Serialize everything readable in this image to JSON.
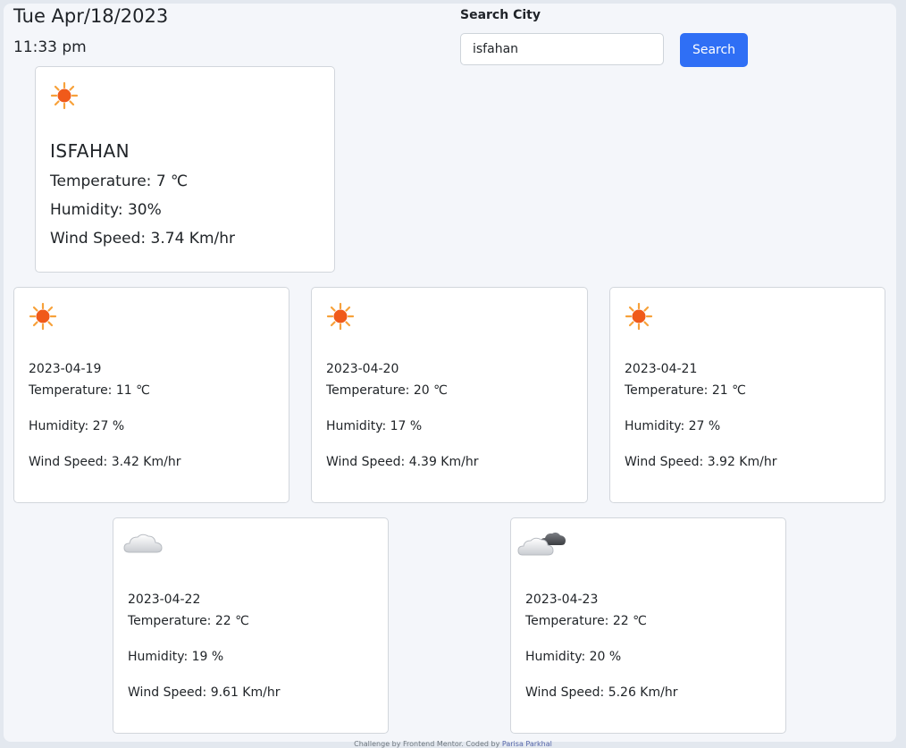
{
  "header": {
    "date": "Tue Apr/18/2023",
    "time": "11:33 pm"
  },
  "search": {
    "label": "Search City",
    "value": "isfahan",
    "placeholder": "",
    "button": "Search"
  },
  "current": {
    "icon": "sun-icon",
    "city": "ISFAHAN",
    "temperature": "Temperature: 7 ℃",
    "humidity": "Humidity: 30%",
    "wind": "Wind Speed: 3.74 Km/hr"
  },
  "forecast": [
    {
      "icon": "sun-icon",
      "date": "2023-04-19",
      "temperature": "Temperature: 11 ℃",
      "humidity": "Humidity: 27 %",
      "wind": "Wind Speed: 3.42 Km/hr"
    },
    {
      "icon": "sun-icon",
      "date": "2023-04-20",
      "temperature": "Temperature: 20 ℃",
      "humidity": "Humidity: 17 %",
      "wind": "Wind Speed: 4.39 Km/hr"
    },
    {
      "icon": "sun-icon",
      "date": "2023-04-21",
      "temperature": "Temperature: 21 ℃",
      "humidity": "Humidity: 27 %",
      "wind": "Wind Speed: 3.92 Km/hr"
    },
    {
      "icon": "cloud-icon",
      "date": "2023-04-22",
      "temperature": "Temperature: 22 ℃",
      "humidity": "Humidity: 19 %",
      "wind": "Wind Speed: 9.61 Km/hr"
    },
    {
      "icon": "cloudy-icon",
      "date": "2023-04-23",
      "temperature": "Temperature: 22 ℃",
      "humidity": "Humidity: 20 %",
      "wind": "Wind Speed: 5.26 Km/hr"
    }
  ],
  "footer": {
    "text": "Challenge by Frontend Mentor. Coded by ",
    "author": "Parisa Parkhal"
  },
  "colors": {
    "accent": "#2f6ff5",
    "sun": "#f05a1a",
    "sun_rays": "#f7a13a"
  }
}
